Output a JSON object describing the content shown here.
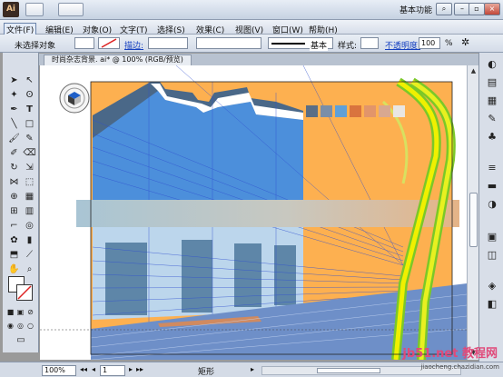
{
  "app": {
    "logo_text": "Ai",
    "workspace": "基本功能"
  },
  "menu": [
    "文件(F)",
    "编辑(E)",
    "对象(O)",
    "文字(T)",
    "选择(S)",
    "效果(C)",
    "视图(V)",
    "窗口(W)",
    "帮助(H)"
  ],
  "control_bar": {
    "selection_label": "未选择对象",
    "stroke_label": "描边:",
    "stroke_style": "基本",
    "style_label": "样式:",
    "opacity_label": "不透明度:",
    "opacity_value": "100",
    "opacity_unit": "%"
  },
  "document": {
    "tab_title": "时尚杂志背景. ai* @ 100% (RGB/预览)"
  },
  "status_bar": {
    "zoom": "100%",
    "page": "1",
    "status_text": "矩形"
  },
  "watermark": {
    "text": "jb51.net  教程网",
    "url": "jiaocheng.chazidian.com"
  },
  "colors": {
    "swatches": [
      "#5a6e86",
      "#7a8ea8",
      "#5fa0d8",
      "#d9743e",
      "#e2956a",
      "#d8a890",
      "#e9e6e2"
    ],
    "background_orange": "#fdb050",
    "building_blue": "#4c8fdb",
    "building_dark": "#4a6888"
  }
}
